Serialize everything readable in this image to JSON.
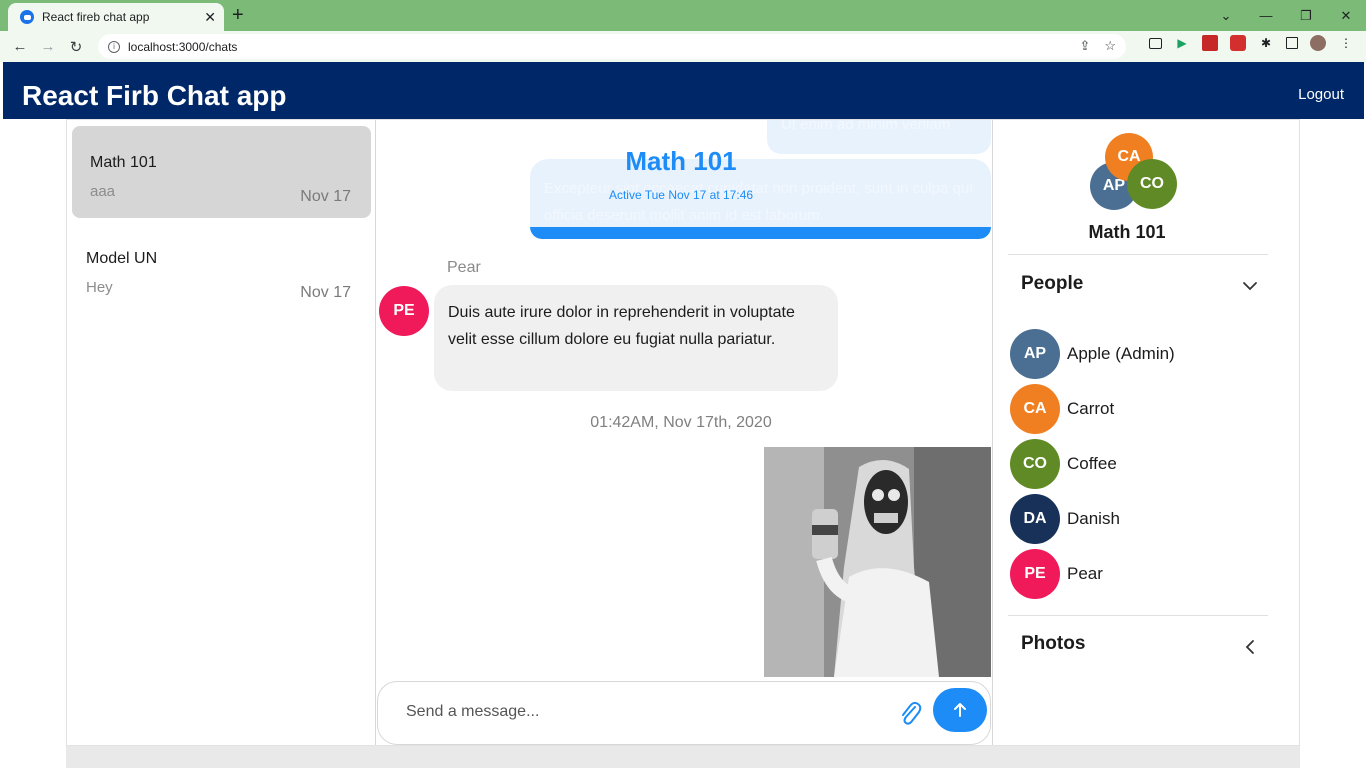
{
  "browser": {
    "tab_title": "React fireb chat app",
    "tab_close": "✕",
    "new_tab": "+",
    "url": "localhost:3000/chats",
    "controls": [
      "⌄",
      "—",
      "❐",
      "✕"
    ]
  },
  "header": {
    "title": "React Firb Chat app",
    "logout_label": "Logout"
  },
  "conversations": [
    {
      "name": "Math 101",
      "preview": "aaa",
      "date": "Nov 17",
      "active": true
    },
    {
      "name": "Model UN",
      "preview": "Hey",
      "date": "Nov 17",
      "active": false
    }
  ],
  "chat": {
    "title": "Math 101",
    "subtitle": "Active Tue Nov 17 at 17:46",
    "outgoing_top": "Ut enim ad minim veniam",
    "outgoing_message": "Excepteur sint occaecat cupidatat non proident, sunt in culpa qui officia deserunt mollit anim id est laborum.",
    "incoming_sender": "Pear",
    "incoming_avatar": "PE",
    "incoming_message": "Duis aute irure dolor in reprehenderit in voluptate velit esse cillum dolore eu fugiat nulla pariatur.",
    "timestamp": "01:42AM, Nov 17th, 2020",
    "composer_placeholder": "Send a message..."
  },
  "info_panel": {
    "group_title": "Math 101",
    "group_avatars": [
      "CA",
      "AP",
      "CO"
    ],
    "people_title": "People",
    "photos_title": "Photos",
    "members": [
      {
        "initials": "AP",
        "name": "Apple (Admin)",
        "color": "#4a6f93"
      },
      {
        "initials": "CA",
        "name": "Carrot",
        "color": "#f07f22"
      },
      {
        "initials": "CO",
        "name": "Coffee",
        "color": "#5f8a25"
      },
      {
        "initials": "DA",
        "name": "Danish",
        "color": "#173158"
      },
      {
        "initials": "PE",
        "name": "Pear",
        "color": "#f0195a"
      }
    ]
  },
  "colors": {
    "header_bg": "#002868",
    "accent": "#1d8cf6",
    "browser_frame": "#7cba78"
  }
}
